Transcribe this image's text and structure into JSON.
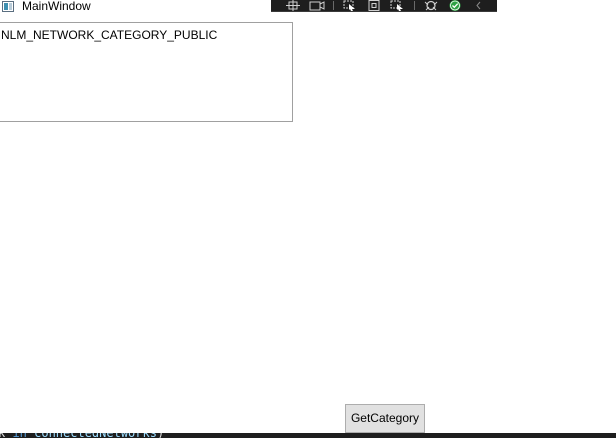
{
  "window": {
    "title": "MainWindow"
  },
  "debug_toolbar": {
    "icons": [
      "select-element-icon",
      "display-layout-icon",
      "track-focused-icon",
      "layout-adorners-icon",
      "hot-reload-icon",
      "accessibility-icon",
      "binding-success-icon",
      "collapse-chevron-icon"
    ],
    "accent_color": "#1e1e1e",
    "success_color": "#2ea043"
  },
  "textbox": {
    "value": "NLM_NETWORK_CATEGORY_PUBLIC"
  },
  "button": {
    "label": "GetCategory"
  },
  "code_strip": {
    "text_prefix": "k ",
    "keyword": "in",
    "identifier": " connectedNetworks",
    "suffix": ")"
  }
}
